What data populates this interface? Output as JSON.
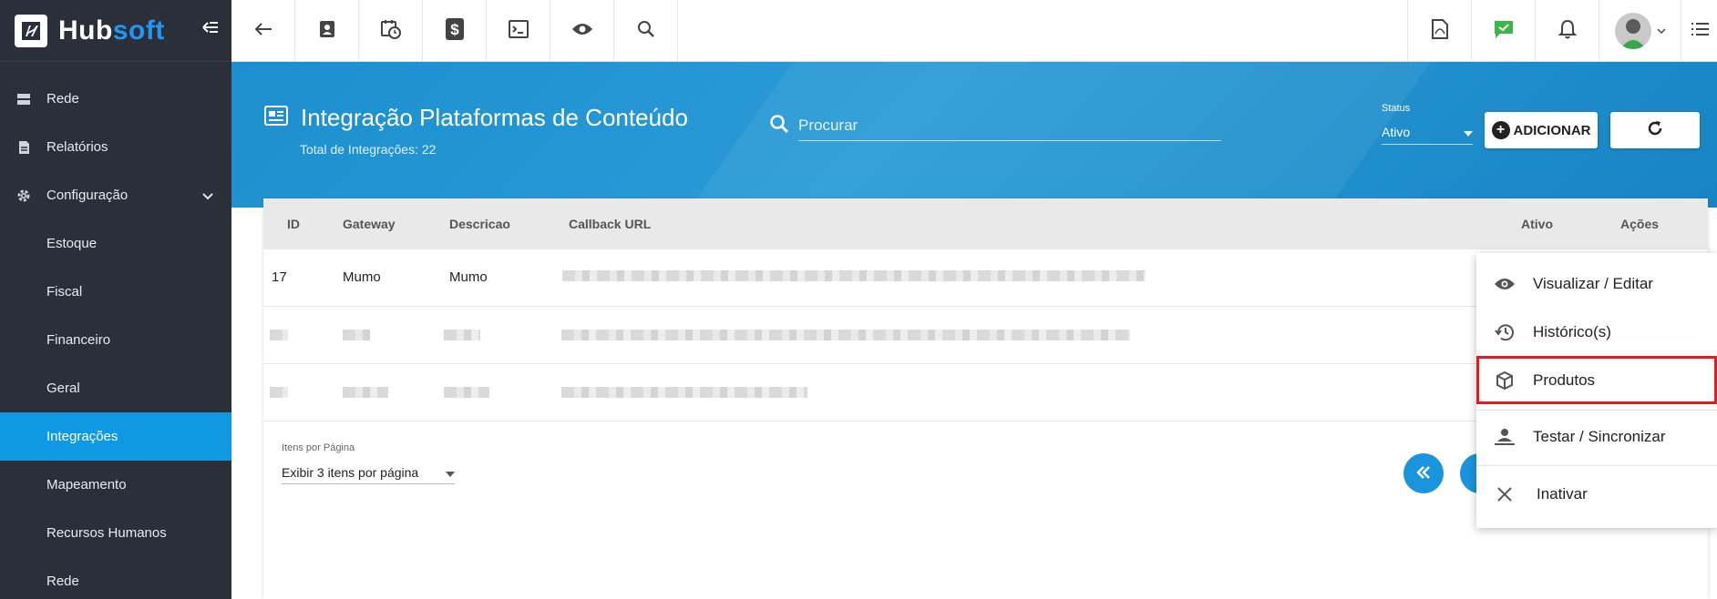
{
  "brand": {
    "name_main": "Hub",
    "name_accent": "soft"
  },
  "sidebar": {
    "items": [
      {
        "label": "Rede",
        "icon": "server-icon"
      },
      {
        "label": "Relatórios",
        "icon": "report-icon"
      },
      {
        "label": "Configuração",
        "icon": "gear-icon"
      },
      {
        "label": "Estoque"
      },
      {
        "label": "Fiscal"
      },
      {
        "label": "Financeiro"
      },
      {
        "label": "Geral"
      },
      {
        "label": "Integrações"
      },
      {
        "label": "Mapeamento"
      },
      {
        "label": "Recursos Humanos"
      },
      {
        "label": "Rede"
      }
    ],
    "active_color": "#0f99e3"
  },
  "page": {
    "title": "Integração Plataformas de Conteúdo",
    "subtitle": "Total de Integrações: 22"
  },
  "search": {
    "placeholder": "Procurar"
  },
  "status": {
    "label": "Status",
    "value": "Ativo"
  },
  "buttons": {
    "add_label": "ADICIONAR"
  },
  "table": {
    "headers": [
      "ID",
      "Gateway",
      "Descricao",
      "Callback URL",
      "Ativo",
      "Ações"
    ],
    "rows": [
      {
        "id": "17",
        "gateway": "Mumo",
        "descricao": "Mumo"
      }
    ]
  },
  "pagination": {
    "items_per_page_label": "Itens por Página",
    "items_per_page_value": "Exibir 3 itens por página"
  },
  "actions_menu": {
    "items": [
      {
        "label": "Visualizar / Editar",
        "icon": "eye-icon"
      },
      {
        "label": "Histórico(s)",
        "icon": "history-icon"
      },
      {
        "label": "Produtos",
        "icon": "box-icon",
        "highlighted": true
      },
      {
        "label": "Testar / Sincronizar",
        "icon": "sync-user-icon"
      },
      {
        "label": "Inativar",
        "icon": "close-icon"
      }
    ],
    "highlight_color": "#e41b1b"
  },
  "colors": {
    "accent": "#1a95dc",
    "sidebar_bg": "#2b2f3a",
    "hero_bg": "#1d8fcf"
  }
}
